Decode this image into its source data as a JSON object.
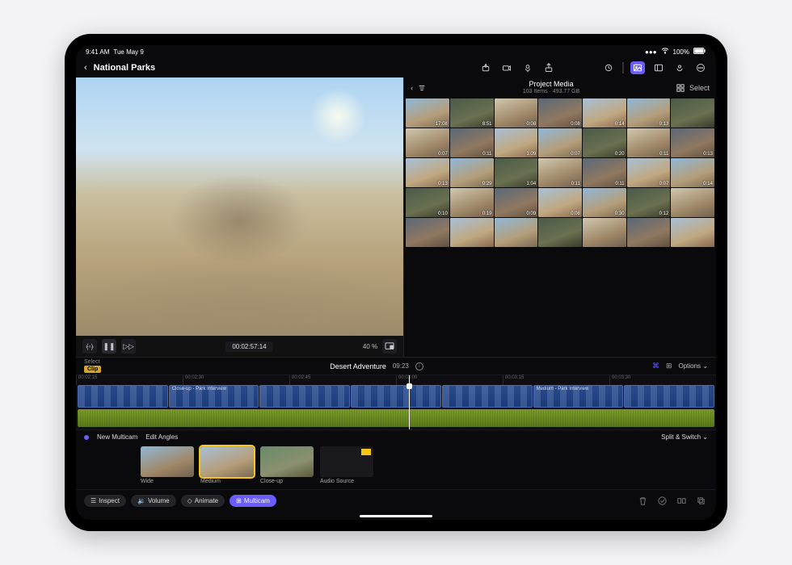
{
  "status": {
    "time": "9:41 AM",
    "date": "Tue May 9",
    "battery": "100%"
  },
  "header": {
    "title": "National Parks"
  },
  "viewer": {
    "timecode": "00:02:57:14",
    "zoom": "40 %"
  },
  "browser": {
    "title": "Project Media",
    "subtitle": "103 Items · 493.77 GB",
    "select_label": "Select",
    "thumbs": [
      {
        "dur": "17:08"
      },
      {
        "dur": "8:51"
      },
      {
        "dur": "0:08"
      },
      {
        "dur": "0:08"
      },
      {
        "dur": "0:14"
      },
      {
        "dur": "0:13"
      },
      {
        "dur": ""
      },
      {
        "dur": "0:07"
      },
      {
        "dur": "0:11"
      },
      {
        "dur": "1:09"
      },
      {
        "dur": "0:07"
      },
      {
        "dur": "0:20"
      },
      {
        "dur": "0:11"
      },
      {
        "dur": "0:13"
      },
      {
        "dur": "0:13"
      },
      {
        "dur": "0:29"
      },
      {
        "dur": "1:04"
      },
      {
        "dur": "0:11"
      },
      {
        "dur": "0:11"
      },
      {
        "dur": "0:07"
      },
      {
        "dur": "0:14"
      },
      {
        "dur": "0:10"
      },
      {
        "dur": "0:19"
      },
      {
        "dur": "0:09"
      },
      {
        "dur": "0:08"
      },
      {
        "dur": "0:30"
      },
      {
        "dur": "0:12"
      },
      {
        "dur": ""
      },
      {
        "dur": ""
      },
      {
        "dur": ""
      },
      {
        "dur": ""
      },
      {
        "dur": ""
      },
      {
        "dur": ""
      },
      {
        "dur": ""
      },
      {
        "dur": ""
      }
    ]
  },
  "timeline_head": {
    "select_label": "Select",
    "clip_tag": "Clip",
    "project_name": "Desert Adventure",
    "duration": "09:23",
    "options_label": "Options"
  },
  "ruler": [
    "00:02:15",
    "00:02:30",
    "00:02:45",
    "00:03:00",
    "00:03:15",
    "00:03:30"
  ],
  "clips": [
    {
      "label": ""
    },
    {
      "label": "Close-up - Park Interview"
    },
    {
      "label": ""
    },
    {
      "label": ""
    },
    {
      "label": ""
    },
    {
      "label": "Medium - Park Interview"
    },
    {
      "label": ""
    }
  ],
  "multicam": {
    "new_label": "New Multicam",
    "edit_label": "Edit Angles",
    "mode_label": "Split & Switch",
    "angles": [
      {
        "name": "Wide"
      },
      {
        "name": "Medium"
      },
      {
        "name": "Close-up"
      },
      {
        "name": "Audio Source"
      }
    ]
  },
  "bottom": {
    "inspect": "Inspect",
    "volume": "Volume",
    "animate": "Animate",
    "multicam": "Multicam"
  }
}
